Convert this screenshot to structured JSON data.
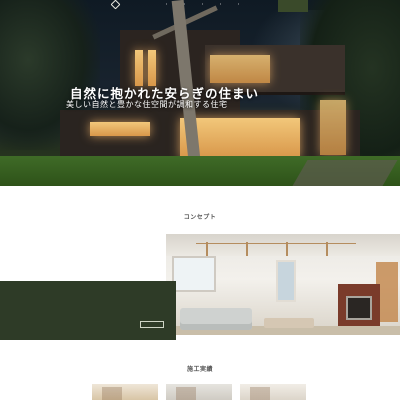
{
  "header": {
    "logo_text": "",
    "nav_items": [
      "",
      "",
      "",
      "",
      ""
    ],
    "cta_label": ""
  },
  "hero": {
    "title": "自然に抱かれた安らぎの住まい",
    "subtitle": "美しい自然と豊かな住空間が調和する住宅"
  },
  "concept": {
    "heading": "コンセプト",
    "heading_en": "",
    "card_title": "",
    "card_lines": [
      "",
      "",
      ""
    ],
    "more_label": ""
  },
  "works": {
    "heading": "施工実績",
    "heading_en": ""
  },
  "colors": {
    "accent_green": "#2e3b27",
    "nav_cta": "#3a4a2a",
    "fireplace": "#7a3b2a"
  }
}
